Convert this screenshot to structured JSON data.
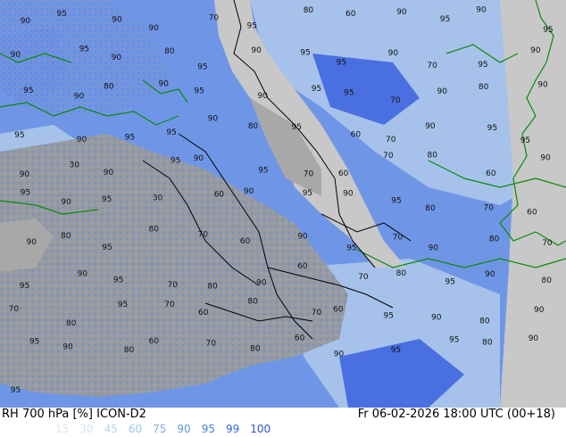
{
  "footer": {
    "title_left": "RH 700 hPa [%] ICON-D2",
    "title_right": "Fr 06-02-2026 18:00 UTC (00+18)"
  },
  "legend": {
    "values": [
      "15",
      "30",
      "45",
      "60",
      "75",
      "90",
      "95",
      "99",
      "100"
    ],
    "colors": [
      "#e4e4e4",
      "#cfe3f3",
      "#b6d6ee",
      "#99c4ea",
      "#7fb0e6",
      "#5e93e0",
      "#4a7ee0",
      "#3366dd",
      "#2a55cc"
    ]
  },
  "map": {
    "colors": {
      "land_grey": "#a8a8a8",
      "sea_grey": "#c8c8c8",
      "light_blue": "#a6c2ea",
      "mid_blue": "#6f96e6",
      "deep_blue": "#4a6fe0",
      "border_green": "#0a8a0a",
      "border_black": "#000000"
    },
    "contour_labels": [
      {
        "t": "90"
      },
      {
        "t": "95"
      },
      {
        "t": "90"
      },
      {
        "t": "90"
      },
      {
        "t": "70"
      },
      {
        "t": "95"
      },
      {
        "t": "80"
      },
      {
        "t": "60"
      },
      {
        "t": "90"
      },
      {
        "t": "95"
      },
      {
        "t": "90"
      },
      {
        "t": "95"
      },
      {
        "t": "90"
      },
      {
        "t": "95"
      },
      {
        "t": "90"
      },
      {
        "t": "80"
      },
      {
        "t": "95"
      },
      {
        "t": "90"
      },
      {
        "t": "95"
      },
      {
        "t": "95"
      },
      {
        "t": "90"
      },
      {
        "t": "70"
      },
      {
        "t": "95"
      },
      {
        "t": "90"
      },
      {
        "t": "95"
      },
      {
        "t": "90"
      },
      {
        "t": "80"
      },
      {
        "t": "90"
      },
      {
        "t": "95"
      },
      {
        "t": "90"
      },
      {
        "t": "95"
      },
      {
        "t": "95"
      },
      {
        "t": "70"
      },
      {
        "t": "90"
      },
      {
        "t": "80"
      },
      {
        "t": "90"
      },
      {
        "t": "95"
      },
      {
        "t": "90"
      },
      {
        "t": "95"
      },
      {
        "t": "95"
      },
      {
        "t": "90"
      },
      {
        "t": "80"
      },
      {
        "t": "95"
      },
      {
        "t": "60"
      },
      {
        "t": "70"
      },
      {
        "t": "90"
      },
      {
        "t": "95"
      },
      {
        "t": "95"
      },
      {
        "t": "90"
      },
      {
        "t": "30"
      },
      {
        "t": "90"
      },
      {
        "t": "95"
      },
      {
        "t": "90"
      },
      {
        "t": "95"
      },
      {
        "t": "70"
      },
      {
        "t": "60"
      },
      {
        "t": "70"
      },
      {
        "t": "80"
      },
      {
        "t": "60"
      },
      {
        "t": "90"
      },
      {
        "t": "95"
      },
      {
        "t": "90"
      },
      {
        "t": "95"
      },
      {
        "t": "30"
      },
      {
        "t": "60"
      },
      {
        "t": "90"
      },
      {
        "t": "95"
      },
      {
        "t": "90"
      },
      {
        "t": "95"
      },
      {
        "t": "80"
      },
      {
        "t": "70"
      },
      {
        "t": "60"
      },
      {
        "t": "90"
      },
      {
        "t": "80"
      },
      {
        "t": "95"
      },
      {
        "t": "80"
      },
      {
        "t": "70"
      },
      {
        "t": "60"
      },
      {
        "t": "90"
      },
      {
        "t": "95"
      },
      {
        "t": "70"
      },
      {
        "t": "90"
      },
      {
        "t": "80"
      },
      {
        "t": "70"
      },
      {
        "t": "95"
      },
      {
        "t": "90"
      },
      {
        "t": "95"
      },
      {
        "t": "70"
      },
      {
        "t": "80"
      },
      {
        "t": "90"
      },
      {
        "t": "60"
      },
      {
        "t": "70"
      },
      {
        "t": "80"
      },
      {
        "t": "95"
      },
      {
        "t": "90"
      },
      {
        "t": "80"
      },
      {
        "t": "70"
      },
      {
        "t": "80"
      },
      {
        "t": "95"
      },
      {
        "t": "70"
      },
      {
        "t": "60"
      },
      {
        "t": "80"
      },
      {
        "t": "70"
      },
      {
        "t": "60"
      },
      {
        "t": "95"
      },
      {
        "t": "90"
      },
      {
        "t": "80"
      },
      {
        "t": "90"
      },
      {
        "t": "95"
      },
      {
        "t": "90"
      },
      {
        "t": "80"
      },
      {
        "t": "60"
      },
      {
        "t": "70"
      },
      {
        "t": "80"
      },
      {
        "t": "60"
      },
      {
        "t": "90"
      },
      {
        "t": "95"
      },
      {
        "t": "95"
      },
      {
        "t": "80"
      },
      {
        "t": "90"
      },
      {
        "t": "95"
      }
    ]
  }
}
